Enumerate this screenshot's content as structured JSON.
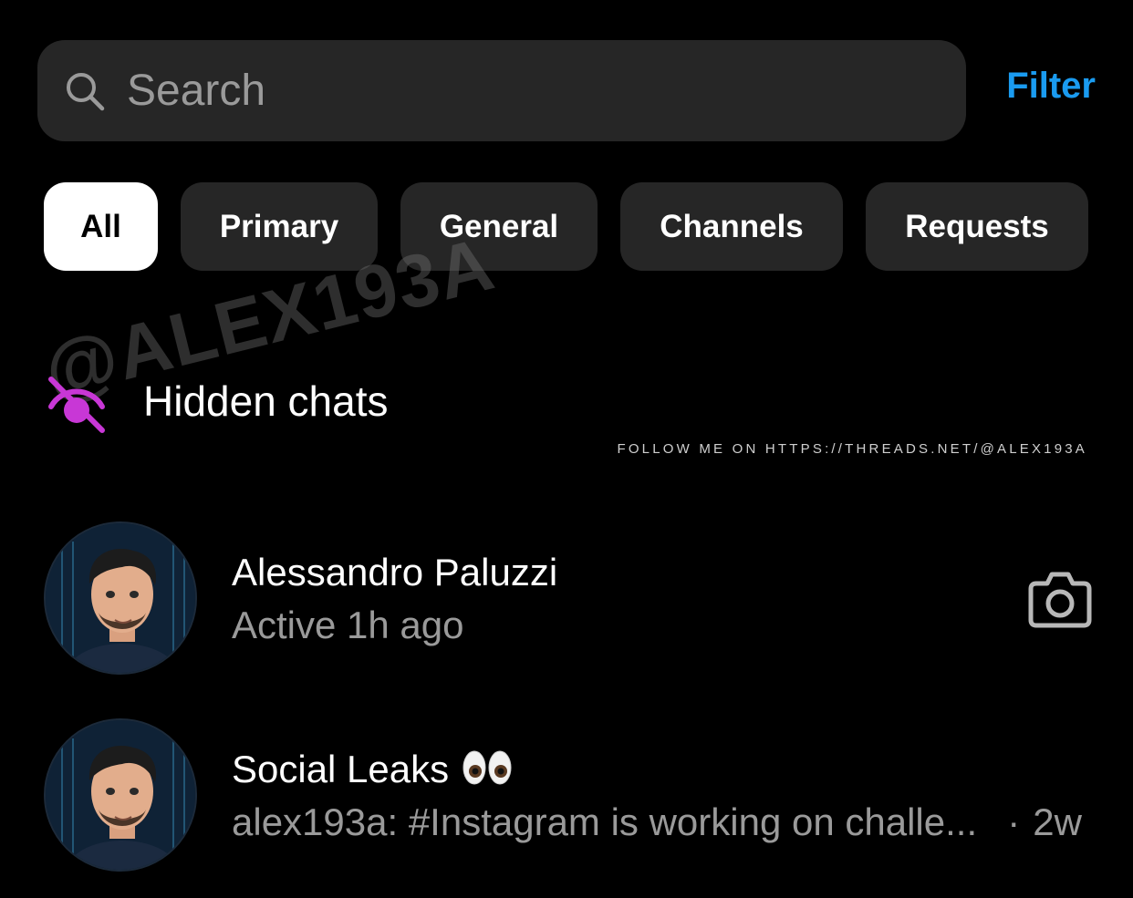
{
  "search": {
    "placeholder": "Search",
    "value": ""
  },
  "filter_label": "Filter",
  "tabs": [
    {
      "label": "All",
      "active": true
    },
    {
      "label": "Primary",
      "active": false
    },
    {
      "label": "General",
      "active": false
    },
    {
      "label": "Channels",
      "active": false
    },
    {
      "label": "Requests",
      "active": false
    }
  ],
  "hidden_chats": {
    "label": "Hidden chats",
    "icon": "eye-off-icon"
  },
  "watermark": {
    "handle": "@ALEX193A",
    "note": "FOLLOW ME ON HTTPS://THREADS.NET/@ALEX193A"
  },
  "chats": [
    {
      "name": "Alessandro Paluzzi",
      "subtitle": "Active 1h ago",
      "action_icon": "camera-icon"
    },
    {
      "name": "Social Leaks",
      "name_emoji": "eyes-emoji",
      "preview": "alex193a: #Instagram is working on challe...",
      "separator": "·",
      "time": "2w"
    }
  ],
  "colors": {
    "background": "#000000",
    "surface": "#262626",
    "accent": "#1a9bf0",
    "hidden_icon": "#c837d6",
    "secondary_text": "#9a9a9a"
  }
}
